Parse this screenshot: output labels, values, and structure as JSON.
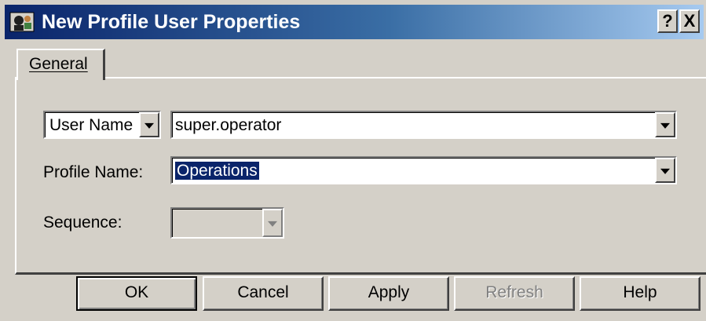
{
  "window": {
    "title": "New Profile User Properties",
    "help_button": "?",
    "close_button": "X"
  },
  "tabs": [
    {
      "label": "General",
      "accesskey": "G",
      "selected": true
    }
  ],
  "form": {
    "key_selector": {
      "label": "User Name",
      "value": "super.operator"
    },
    "profile_name": {
      "label": "Profile Name:",
      "value": "Operations",
      "text_selected": true
    },
    "sequence": {
      "label": "Sequence:",
      "value": "",
      "disabled": true
    }
  },
  "buttons": {
    "ok": "OK",
    "cancel": "Cancel",
    "apply": "Apply",
    "refresh": "Refresh",
    "help": "Help"
  },
  "colors": {
    "titlebar_start": "#0a246a",
    "titlebar_end": "#a6caf0",
    "face": "#d4d0c8",
    "selection": "#0a246a"
  }
}
